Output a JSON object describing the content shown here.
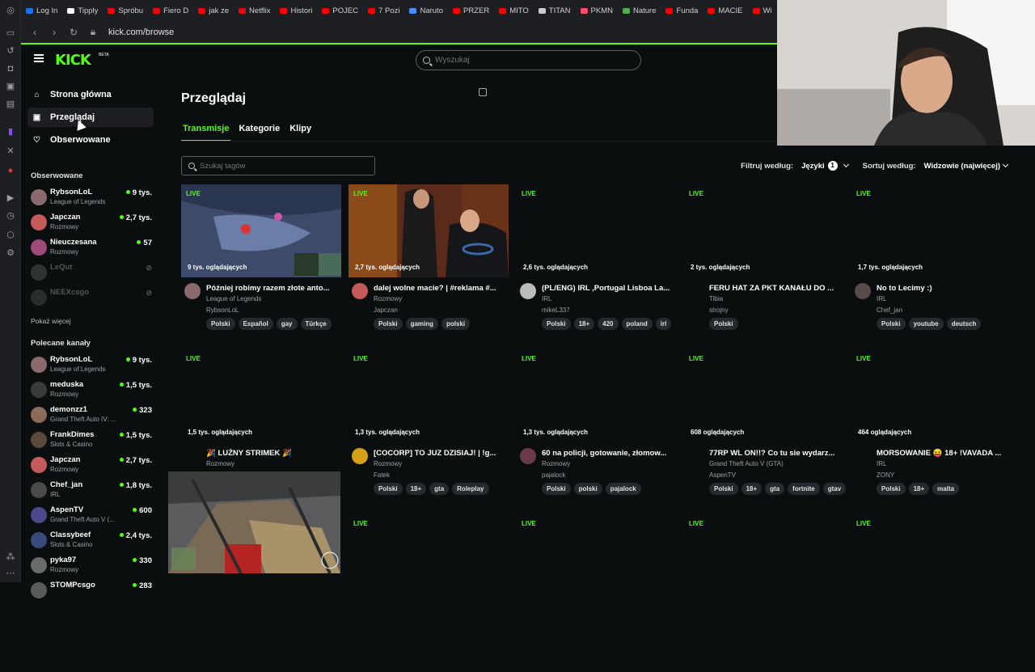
{
  "browser": {
    "url": "kick.com/browse",
    "bookmarks": [
      {
        "label": "Log In",
        "color": "#1a73e8"
      },
      {
        "label": "Tipply",
        "color": "#ffffff"
      },
      {
        "label": "Spróbu",
        "color": "#ff0000"
      },
      {
        "label": "Fiero D",
        "color": "#ff0000"
      },
      {
        "label": "jak ze",
        "color": "#ff0000"
      },
      {
        "label": "Netflix",
        "color": "#e50914"
      },
      {
        "label": "Histori",
        "color": "#ff0000"
      },
      {
        "label": "POJEC",
        "color": "#ff0000"
      },
      {
        "label": "7 Pozi",
        "color": "#ff0000"
      },
      {
        "label": "Naruto",
        "color": "#4a8cff"
      },
      {
        "label": "PRZER",
        "color": "#ff0000"
      },
      {
        "label": "MITO",
        "color": "#ff0000"
      },
      {
        "label": "TITAN",
        "color": "#cccccc"
      },
      {
        "label": "PKMN",
        "color": "#ff4d6d"
      },
      {
        "label": "Nature",
        "color": "#4caf50"
      },
      {
        "label": "Funda",
        "color": "#ff0000"
      },
      {
        "label": "MACIE",
        "color": "#ff0000"
      },
      {
        "label": "Wi",
        "color": "#ff0000"
      }
    ]
  },
  "header": {
    "logo": "KICK",
    "logo_beta": "BETA",
    "search_placeholder": "Wyszukaj"
  },
  "nav": {
    "home": "Strona główna",
    "browse": "Przeglądaj",
    "following": "Obserwowane"
  },
  "followed": {
    "title": "Obserwowane",
    "channels": [
      {
        "name": "RybsonLoL",
        "category": "League of Legends",
        "viewers": "9 tys.",
        "online": true,
        "color": "#8a6a6a"
      },
      {
        "name": "Japczan",
        "category": "Rozmowy",
        "viewers": "2,7 tys.",
        "online": true,
        "color": "#c55a5a"
      },
      {
        "name": "Nieuczesana",
        "category": "Rozmowy",
        "viewers": "57",
        "online": true,
        "color": "#a04a7a"
      },
      {
        "name": "LeQut",
        "category": "",
        "viewers": "",
        "online": false,
        "color": "#777777"
      },
      {
        "name": "NEEXcsgo",
        "category": "",
        "viewers": "",
        "online": false,
        "color": "#666666"
      }
    ],
    "show_more": "Pokaż więcej"
  },
  "recommended": {
    "title": "Polecane kanały",
    "channels": [
      {
        "name": "RybsonLoL",
        "category": "League of Legends",
        "viewers": "9 tys.",
        "color": "#8a6a6a"
      },
      {
        "name": "meduska",
        "category": "Rozmowy",
        "viewers": "1,5 tys.",
        "color": "#3a3a3a"
      },
      {
        "name": "demonzz1",
        "category": "Grand Theft Auto IV: ...",
        "viewers": "323",
        "color": "#8b6b5a"
      },
      {
        "name": "FrankDimes",
        "category": "Slots & Casino",
        "viewers": "1,5 tys.",
        "color": "#5a4a3a"
      },
      {
        "name": "Japczan",
        "category": "Rozmowy",
        "viewers": "2,7 tys.",
        "color": "#c55a5a"
      },
      {
        "name": "Chef_jan",
        "category": "IRL",
        "viewers": "1,8 tys.",
        "color": "#4a4a4a"
      },
      {
        "name": "AspenTV",
        "category": "Grand Theft Auto V (...",
        "viewers": "600",
        "color": "#4a4a8a"
      },
      {
        "name": "Classybeef",
        "category": "Slots & Casino",
        "viewers": "2,4 tys.",
        "color": "#3a4a7a"
      },
      {
        "name": "pyka97",
        "category": "Rozmowy",
        "viewers": "330",
        "color": "#6a6a6a"
      },
      {
        "name": "STOMPcsgo",
        "category": "",
        "viewers": "283",
        "color": "#5a5a5a"
      }
    ]
  },
  "main": {
    "title": "Przeglądaj",
    "tabs": [
      "Transmisje",
      "Kategorie",
      "Klipy"
    ],
    "tag_search_placeholder": "Szukaj tagów",
    "filter_label": "Filtruj według:",
    "languages_label": "Języki",
    "languages_count": "1",
    "sort_label": "Sortuj według:",
    "sort_value": "Widzowie (najwięcej)",
    "live_label": "LIVE"
  },
  "streams": [
    {
      "viewers": "9 tys. oglądających",
      "title": "Później robimy razem złote anto...",
      "category": "League of Legends",
      "user": "RybsonLoL",
      "tags": [
        "Polski",
        "Español",
        "gay",
        "Türkçe"
      ],
      "avatar_color": "#8a6a6a",
      "thumb": "lol"
    },
    {
      "viewers": "2,7 tys. oglądających",
      "title": "dalej wolne macie? | #reklama #...",
      "category": "Rozmowy",
      "user": "Japczan",
      "tags": [
        "Polski",
        "gaming",
        "polski"
      ],
      "avatar_color": "#c55a5a",
      "thumb": "room"
    },
    {
      "viewers": "2,6 tys. oglądających",
      "title": "(PL/ENG) IRL ,Portugal Lisboa La...",
      "category": "IRL",
      "user": "mikeL337",
      "tags": [
        "Polski",
        "18+",
        "420",
        "poland",
        "irl"
      ],
      "avatar_color": "#bbbbbb",
      "thumb": ""
    },
    {
      "viewers": "2 tys. oglądających",
      "title": "FERU HAT ZA PKT KANAŁU DO ...",
      "category": "Tibia",
      "user": "strojny",
      "tags": [
        "Polski"
      ],
      "avatar_color": "#0b0e0f",
      "thumb": ""
    },
    {
      "viewers": "1,7 tys. oglądających",
      "title": "No to Lecimy :)",
      "category": "IRL",
      "user": "Chef_jan",
      "tags": [
        "Polski",
        "youtube",
        "deutsch"
      ],
      "avatar_color": "#5a4a4a",
      "thumb": ""
    },
    {
      "viewers": "1,5 tys. oglądających",
      "title": "🎉 LUŹNY STRIMEK 🎉",
      "category": "Rozmowy",
      "user": "",
      "tags": [],
      "avatar_color": "#0b0e0f",
      "thumb": ""
    },
    {
      "viewers": "1,3 tys. oglądających",
      "title": "[COCORP] TO JUZ DZISIAJ! | !g...",
      "category": "Rozmowy",
      "user": "Fatek",
      "tags": [
        "Polski",
        "18+",
        "gta",
        "Roleplay"
      ],
      "avatar_color": "#d4a017",
      "thumb": ""
    },
    {
      "viewers": "1,3 tys. oglądających",
      "title": "60 na policji, gotowanie, złomow...",
      "category": "Rozmowy",
      "user": "pajalock",
      "tags": [
        "Polski",
        "polski",
        "pajalock"
      ],
      "avatar_color": "#6a3a4a",
      "thumb": ""
    },
    {
      "viewers": "608 oglądających",
      "title": "77RP WL ON!!? Co tu sie wydarz...",
      "category": "Grand Theft Auto V (GTA)",
      "user": "AspenTV",
      "tags": [
        "Polski",
        "18+",
        "gta",
        "fortnite",
        "gtav"
      ],
      "avatar_color": "#0b0e0f",
      "thumb": ""
    },
    {
      "viewers": "464 oglądających",
      "title": "MORSOWANIE 😝 18+ !VAVADA ...",
      "category": "IRL",
      "user": "ZONY",
      "tags": [
        "Polski",
        "18+",
        "malta"
      ],
      "avatar_color": "#0b0e0f",
      "thumb": ""
    },
    {
      "viewers": "",
      "title": "",
      "category": "",
      "user": "",
      "tags": [],
      "avatar_color": "#0b0e0f",
      "thumb": ""
    },
    {
      "viewers": "",
      "title": "",
      "category": "",
      "user": "",
      "tags": [],
      "avatar_color": "#0b0e0f",
      "thumb": ""
    },
    {
      "viewers": "",
      "title": "",
      "category": "",
      "user": "",
      "tags": [],
      "avatar_color": "#0b0e0f",
      "thumb": ""
    },
    {
      "viewers": "",
      "title": "",
      "category": "",
      "user": "",
      "tags": [],
      "avatar_color": "#0b0e0f",
      "thumb": ""
    },
    {
      "viewers": "",
      "title": "",
      "category": "",
      "user": "",
      "tags": [],
      "avatar_color": "#0b0e0f",
      "thumb": ""
    }
  ]
}
